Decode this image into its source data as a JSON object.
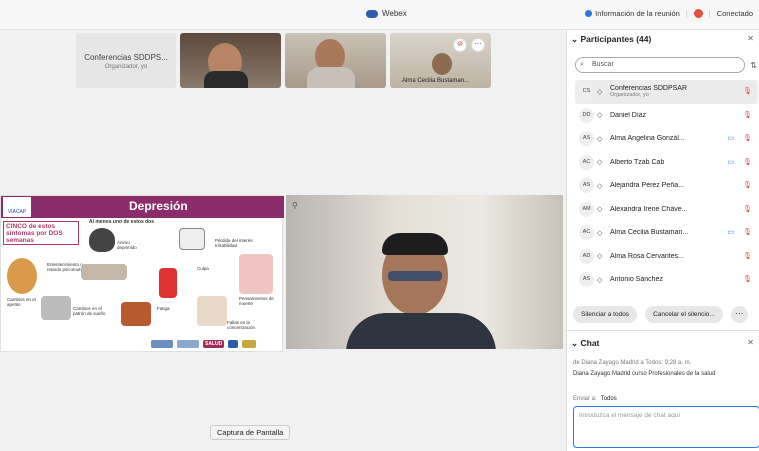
{
  "window": {
    "app_title": "Webex",
    "meeting_info": "Información de la reunión",
    "status": "Conectado"
  },
  "stage": {
    "organizer_card": {
      "name": "Conferencias SDDPS...",
      "role": "Organizador, yo"
    },
    "tile4_label": "Alma Cecilia Bustaman...",
    "slide": {
      "title": "Depresión",
      "logo": "VIACAP",
      "box_text": "CINCO de estos síntomas por DOS semanas",
      "subtitle": "Al menos uno de estos dos",
      "labels": {
        "animo": "Ánimo deprimido",
        "interes": "Pérdida del interés Irritabilidad",
        "enlentecimiento": "Enlentecimiento o retardo psicomotor",
        "culpa": "Culpa",
        "pensamientos": "Pensamientos de muerte",
        "cambios_apetito": "Cambios en el apetito",
        "cambios_sueno": "Cambios en el patrón de sueño",
        "fatiga": "Fatiga",
        "fallas": "Fallas en la concentración"
      },
      "footer_logos": [
        "SALUD"
      ]
    },
    "tooltip": "Captura de Pantalla"
  },
  "participants": {
    "header": "Participantes (44)",
    "search_placeholder": "Buscar",
    "list": [
      {
        "initials": "CS",
        "name": "Conferencias SDDPSAR",
        "sub": "Organizador, yo",
        "selected": true,
        "camera": false,
        "extra": ""
      },
      {
        "initials": "DD",
        "name": "Daniel Díaz",
        "sub": "",
        "selected": false,
        "camera": false,
        "extra": ""
      },
      {
        "initials": "AS",
        "name": "Alma Angelina Gonzál...",
        "sub": "",
        "selected": false,
        "camera": true,
        "extra": ""
      },
      {
        "initials": "AC",
        "name": "Alberto Tzab Cab",
        "sub": "",
        "selected": false,
        "camera": true,
        "extra": ""
      },
      {
        "initials": "AS",
        "name": "Alejandra Pérez Peña...",
        "sub": "",
        "selected": false,
        "camera": false,
        "extra": ""
      },
      {
        "initials": "AM",
        "name": "Alexandra Irene Cháve...",
        "sub": "",
        "selected": false,
        "camera": false,
        "extra": ""
      },
      {
        "initials": "AC",
        "name": "Alma Cecilia Bustaman...",
        "sub": "",
        "selected": false,
        "camera": true,
        "extra": ""
      },
      {
        "initials": "AD",
        "name": "Alma Rosa Cervantes...",
        "sub": "",
        "selected": false,
        "camera": false,
        "extra": ""
      },
      {
        "initials": "AS",
        "name": "Antonio Sánchez",
        "sub": "",
        "selected": false,
        "camera": false,
        "extra": ""
      }
    ],
    "mute_all": "Silenciar a todos",
    "cancel_mute": "Cancelar el silencio..."
  },
  "chat": {
    "header": "Chat",
    "meta": "de Diana Zayago Madrid a Todos:   9:28  a. m.",
    "message": "Diana Zayago Madrid curso  Profesionales de la salud",
    "send_to_label": "Enviar a:",
    "send_to_value": "Todos",
    "input_placeholder": "Introduzca el mensaje de chat aquí"
  }
}
